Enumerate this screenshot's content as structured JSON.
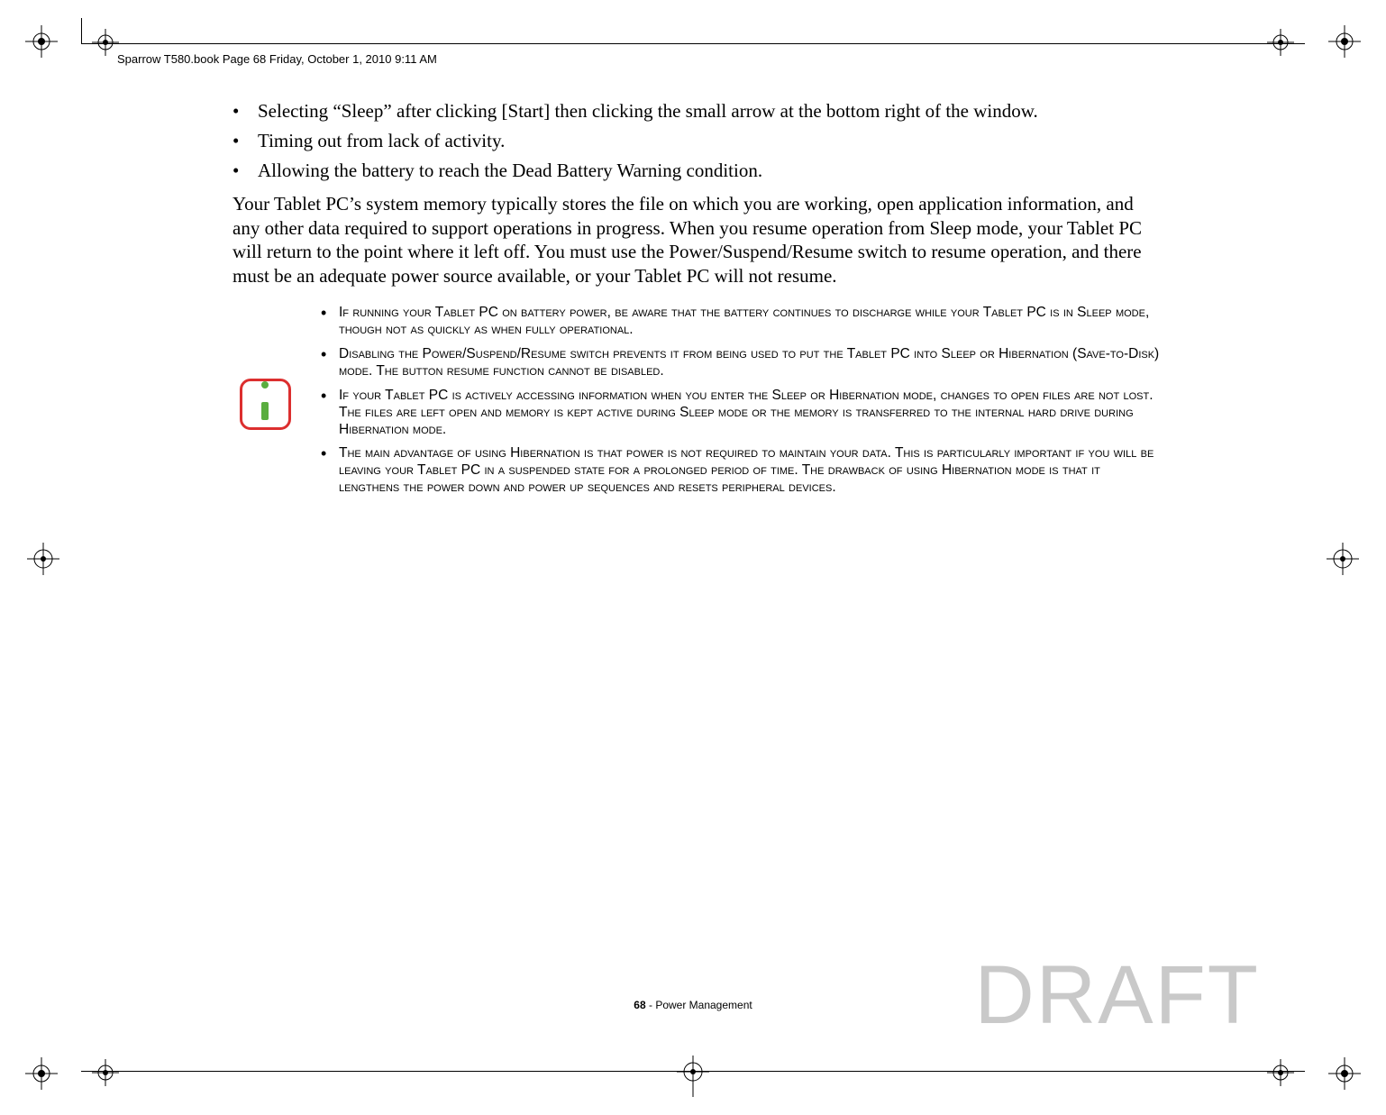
{
  "header": {
    "running_text": "Sparrow T580.book  Page 68  Friday, October 1, 2010  9:11 AM"
  },
  "bullets": [
    "Selecting “Sleep” after clicking [Start] then clicking the small arrow at the bottom right of the window.",
    "Timing out from lack of activity.",
    "Allowing the battery to reach the Dead Battery Warning condition."
  ],
  "body_paragraph": "Your Tablet PC’s system memory typically stores the file on which you are working, open application information, and any other data required to support operations in progress. When you resume operation from Sleep mode, your Tablet PC will return to the point where it left off. You must use the Power/Suspend/Resume switch to resume operation, and there must be an adequate power source available, or your Tablet PC will not resume.",
  "info_items": [
    "If running your Tablet PC on battery power, be aware that the battery continues to discharge while your Tablet PC is in Sleep mode, though not as quickly as when fully operational.",
    "Disabling the Power/Suspend/Resume switch prevents it from being used to put the Tablet PC into Sleep or Hibernation (Save-to-Disk) mode. The button resume function cannot be disabled.",
    "If your Tablet PC is actively accessing information when you enter the Sleep or Hibernation mode, changes to open files are not lost. The files are left open and memory is kept active during Sleep mode or the memory is transferred to the internal hard drive during Hibernation mode.",
    "The main advantage of using Hibernation is that power is not required to maintain your data. This is particularly important if you will be leaving your Tablet PC in a suspended state for a prolonged period of time. The drawback of using Hibernation mode is that it lengthens the power down and power up sequences and resets peripheral devices."
  ],
  "footer": {
    "page_number": "68",
    "section": " - Power Management"
  },
  "watermark": "DRAFT",
  "icon": {
    "name": "info-icon",
    "border_color": "#dc2f2f",
    "accent_color": "#5aad3f"
  }
}
